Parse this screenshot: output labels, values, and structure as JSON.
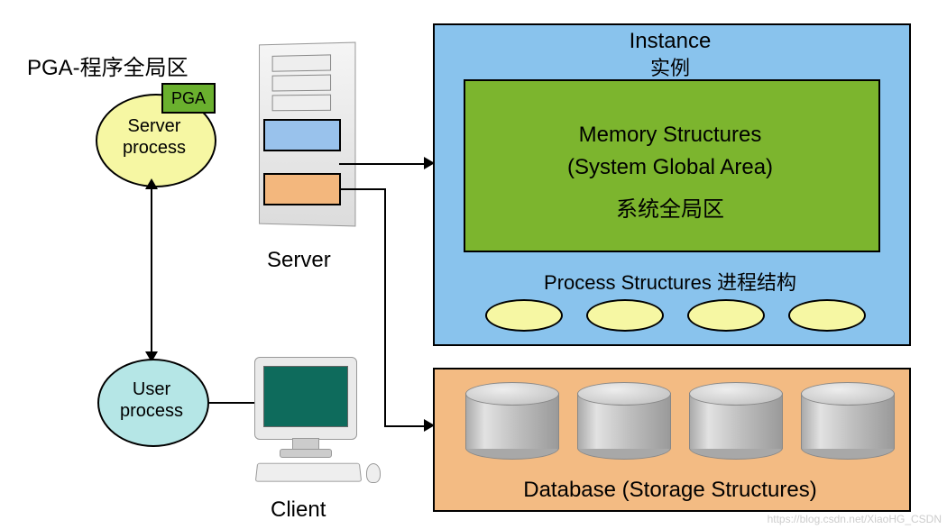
{
  "title": "PGA-程序全局区",
  "serverProcess": {
    "label": "Server\nprocess",
    "label_line1": "Server",
    "label_line2": "process"
  },
  "pga": {
    "label": "PGA"
  },
  "userProcess": {
    "label_line1": "User",
    "label_line2": "process"
  },
  "server": {
    "caption": "Server"
  },
  "client": {
    "caption": "Client"
  },
  "instance": {
    "title_en": "Instance",
    "title_zh": "实例",
    "memory": {
      "line1": "Memory Structures",
      "line2": "(System Global Area)",
      "line3": "系统全局区"
    },
    "processStructures": "Process Structures 进程结构",
    "processCount": 4
  },
  "database": {
    "label": "Database (Storage Structures)",
    "cylinderCount": 4
  },
  "watermark": "https://blog.csdn.net/XiaoHG_CSDN"
}
